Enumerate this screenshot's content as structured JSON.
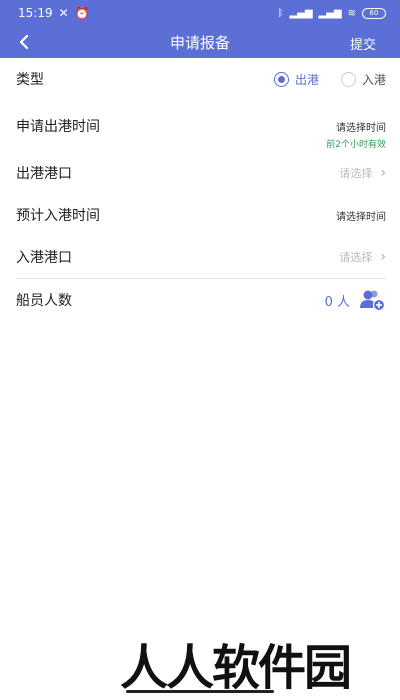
{
  "status_bar": {
    "time": "15:19",
    "battery": "60"
  },
  "header": {
    "title": "申请报备",
    "submit_label": "提交"
  },
  "form": {
    "type": {
      "label": "类型",
      "options": [
        "出港",
        "入港"
      ],
      "selected": "出港"
    },
    "departure_time": {
      "label": "申请出港时间",
      "value": "请选择时间",
      "hint": "前2个小时有效"
    },
    "departure_port": {
      "label": "出港港口",
      "placeholder": "请选择"
    },
    "arrival_time": {
      "label": "预计入港时间",
      "value": "请选择时间"
    },
    "arrival_port": {
      "label": "入港港口",
      "placeholder": "请选择"
    },
    "crew": {
      "label": "船员人数",
      "count": "0 人"
    }
  },
  "watermark": "人人软件园",
  "colors": {
    "primary": "#5b6fd6",
    "hint_green": "#2f9e5b"
  }
}
